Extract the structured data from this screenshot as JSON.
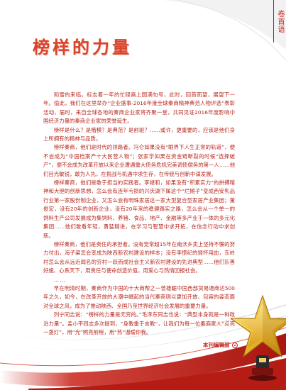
{
  "side_tab": {
    "text": "卷首语"
  },
  "title": "榜样的力量",
  "paragraphs": [
    "和雪的来临，标志着一年的忙碌画上圆满句号，此时，回首而望，展望下一年。值此，我们在这里举办“企业盛事·2016年度全球秦商精神典范人物评选”表彰活动，届时，来自全球各地的秦商企业家将齐聚一堂，共同见证2016年度影响中国经济力量的秦商企业家的荣誉诞生。",
    "榜样是什么？是楷模？是典范？是前驱？……或许，更重要的，应该是他们身上所拥有的精神与品质。",
    "榜样秦商，他们是时代的领路者。冯仑如果没有“眼界下人生正常的轨道”，便不会成为“中国档案产十大民营人物”；张家学如果在资金链断裂的时候“选择破产”，便不会成为改革开放以来企业遭遇重大债务危机完美调债偿务的第一人……他们目光敏锐，敢为人先，在挑战与机遇中求生存，在传统与创新中谋发展。",
    "榜样秦商，他们是敢于担当的实践者。李继和，如果没有“积累实力”的拼搏精神和大胆的创新思想，怎么会有连年亏损的兴庆湖下属这个“烂摊子”变成西安乳品行业第一家股份制企业，又怎么会有明珠家居这一家大型复合型家居产业集团；董俊宏，没有20年的创新企业，没有20年来的稳健路实之路，怎么会从一个单一的饲料生产公司发展成为集饲料、养猪、食品、地产、金融等多产业于一体的多元化集团……他们敢看年轻，勇猛精进，在学习与智慧中求开拓，在信念行动中求创新。",
    "榜样秦商，他们是责任的承担者。没有党常超15年在南沃乡卖上坚持不懈的努力付出，海子梁怎会变成为陕西新农村建设的样本；没有李憬纪的情怀用血，东岭村怎么会从远近闻名的穷村一跃而成社会主义新农村建设的先进典型……他们乐善好施、心系天下，用责任与使命创造价值，用爱心与热情回报社会。",
    "……",
    "早在明清时期，秦商作为中国的十大商帮之一曾雄踞中国西部贸易通商达500年之久，如今，在改革开放的大潮中崛起的当代秦商则以更加开放、包容的姿态面对全球之风，成为了推动陕西、全国乃至世界经济社会发展的重要力量。",
    "列宁同志说：“榜样的力量是无穷的。”毛泽东同志也说：“典型本身就是一种政治力量”。孟小平同志多次提到，“身教重于言教”，让我们为每一位秦商家人“点亮一盏灯”，用“光”照亮前程，用“热”温暖你我。"
  ],
  "signature": "本刊编辑部"
}
